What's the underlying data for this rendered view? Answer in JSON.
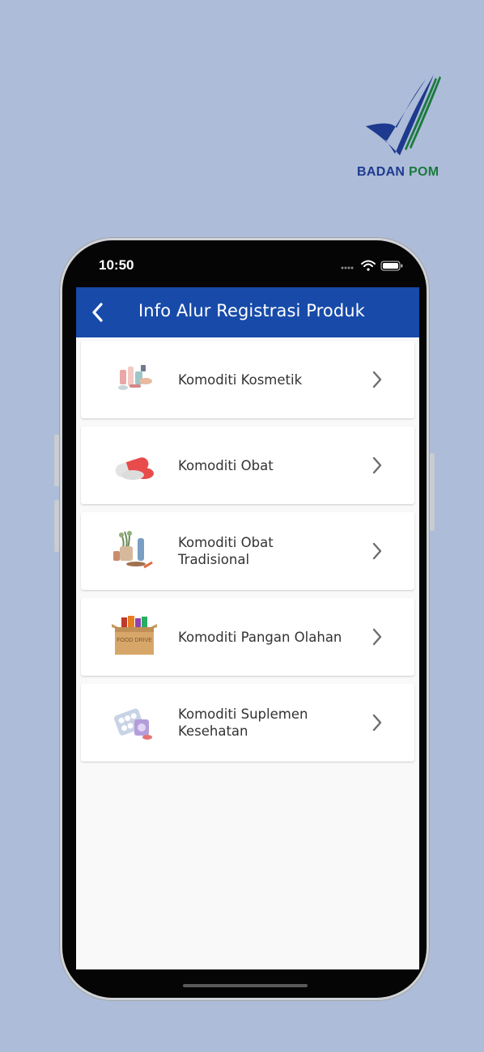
{
  "brand": {
    "logo_word1": "BADAN",
    "logo_word2": "POM"
  },
  "status_bar": {
    "time": "10:50",
    "icons": [
      "signal-dots-icon",
      "wifi-icon",
      "battery-icon"
    ]
  },
  "header": {
    "back_icon": "chevron-left-icon",
    "title": "Info Alur Registrasi Produk"
  },
  "commodities": [
    {
      "label": "Komoditi Kosmetik",
      "icon": "cosmetics-illustration"
    },
    {
      "label": "Komoditi Obat",
      "icon": "capsule-illustration"
    },
    {
      "label": "Komoditi Obat Tradisional",
      "icon": "herbal-illustration"
    },
    {
      "label": "Komoditi Pangan Olahan",
      "icon": "food-box-illustration",
      "image_text": "FOOD DRIVE"
    },
    {
      "label": "Komoditi Suplemen Kesehatan",
      "icon": "supplement-illustration"
    }
  ],
  "colors": {
    "background": "#adbcd8",
    "appbar": "#174aa9",
    "logo_blue": "#1d3a8f",
    "logo_green": "#1b7a3e"
  }
}
